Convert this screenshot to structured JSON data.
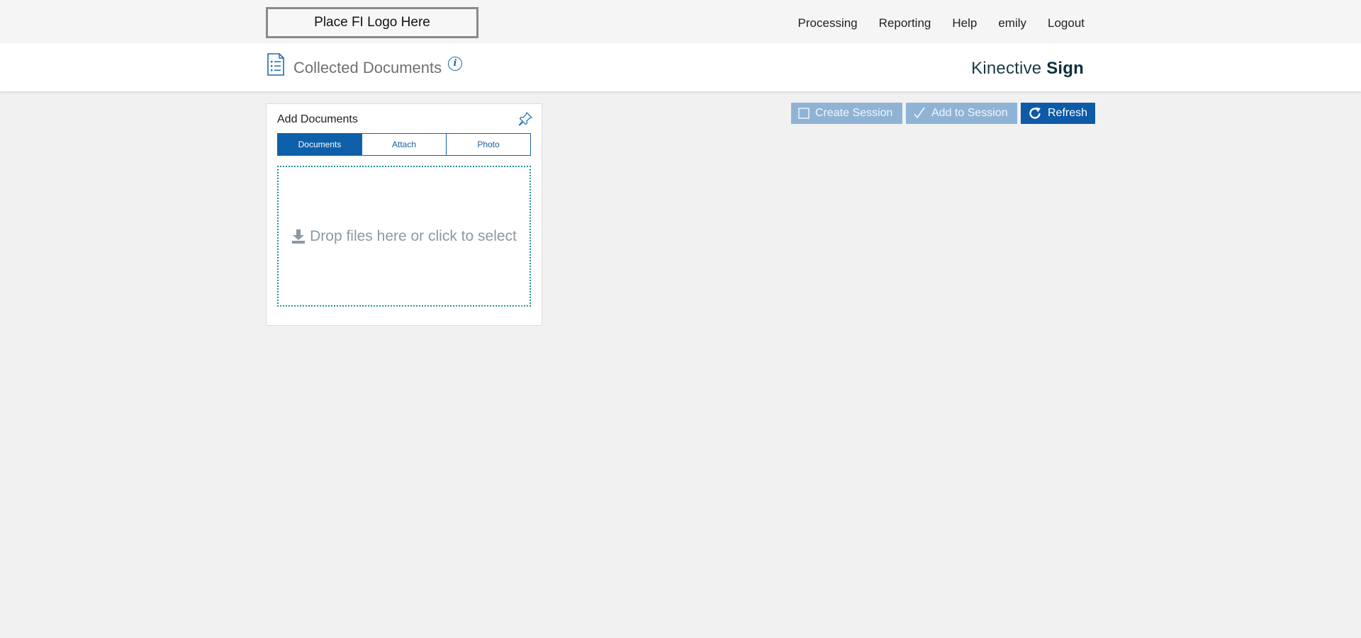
{
  "header": {
    "logo_placeholder": "Place FI Logo Here",
    "nav": [
      "Processing",
      "Reporting",
      "Help",
      "emily",
      "Logout"
    ]
  },
  "page": {
    "title": "Collected Documents",
    "info_label": "i",
    "brand_light": "Kinective",
    "brand_bold": "Sign"
  },
  "panel": {
    "title": "Add Documents",
    "tabs": [
      {
        "label": "Documents",
        "active": true
      },
      {
        "label": "Attach",
        "active": false
      },
      {
        "label": "Photo",
        "active": false
      }
    ],
    "dropzone_text": "Drop files here or click to select"
  },
  "actions": {
    "create_session": "Create Session",
    "add_to_session": "Add to Session",
    "refresh": "Refresh"
  },
  "colors": {
    "primary": "#0d5aa7",
    "disabled_button": "#8fb3d5",
    "dropzone_border": "#1f8f9a",
    "brand_text": "#0e2f3c"
  },
  "icons": {
    "page": "document-list-icon",
    "info": "info-icon",
    "pin": "pin-icon",
    "dropzone": "download-icon",
    "create_session": "checkbox-empty-icon",
    "add_to_session": "checkmark-icon",
    "refresh": "refresh-icon"
  }
}
